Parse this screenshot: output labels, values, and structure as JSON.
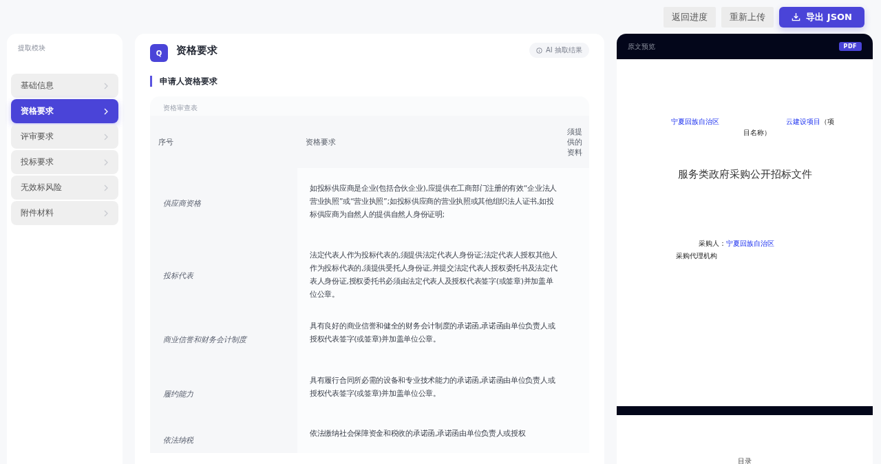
{
  "toolbar": {
    "buttons": [
      {
        "label": "返回进度",
        "kind": "secondary"
      },
      {
        "label": "重新上传",
        "kind": "secondary"
      },
      {
        "label": "导出 JSON",
        "kind": "primary"
      }
    ]
  },
  "sidebar": {
    "title": "提取模块",
    "items": [
      {
        "label": "基础信息",
        "selected": false
      },
      {
        "label": "资格要求",
        "selected": true
      },
      {
        "label": "评审要求",
        "selected": false
      },
      {
        "label": "投标要求",
        "selected": false
      },
      {
        "label": "无效标风险",
        "selected": false
      },
      {
        "label": "附件材料",
        "selected": false
      }
    ]
  },
  "main": {
    "badge": "Q",
    "title": "资格要求",
    "tag": "AI 抽取结果",
    "section": "申请人资格要求",
    "table": {
      "caption": "资格审查表",
      "columns": [
        "序号",
        "资格要求",
        "须提供的资料"
      ],
      "rows": [
        {
          "name": "供应商资格",
          "requirement": "如投标供应商是企业(包括合伙企业),应提供在工商部门注册的有效“企业法人营业执照”或“营业执照”;如投标供应商的营业执照或其他组织法人证书,如投标供应商为自然人的提供自然人身份证明;"
        },
        {
          "name": "投标代表",
          "requirement": "法定代表人作为投标代表的,须提供法定代表人身份证;法定代表人授权其他人作为投标代表的,须提供受托人身份证,并提交法定代表人授权委托书及法定代表人身份证,授权委托书必须由法定代表人及授权代表签字(或签章)并加盖单位公章。"
        },
        {
          "name": "商业信誉和财务会计制度",
          "requirement": "具有良好的商业信誉和健全的财务会计制度的承诺函,承诺函由单位负责人或授权代表签字(或签章)并加盖单位公章。"
        },
        {
          "name": "履约能力",
          "requirement": "具有履行合同所必需的设备和专业技术能力的承诺函,承诺函由单位负责人或授权代表签字(或签章)并加盖单位公章。"
        },
        {
          "name": "依法纳税",
          "requirement": "依法缴纳社会保障资金和税收的承诺函,承诺函由单位负责人或授权"
        }
      ]
    }
  },
  "preview": {
    "title": "原文预览",
    "badge": "PDF",
    "cover": {
      "region": "宁夏回族自治区",
      "project": "云建设项目",
      "project_suffix": "（项",
      "project_suffix_2": "目名称）",
      "doc_title": "服务类政府采购公开招标文件",
      "purchaser_label": "采购人：",
      "purchaser_value": "宁夏回族自治区",
      "agent_label": "采购代理机构"
    },
    "toc": {
      "title": "目录"
    }
  }
}
